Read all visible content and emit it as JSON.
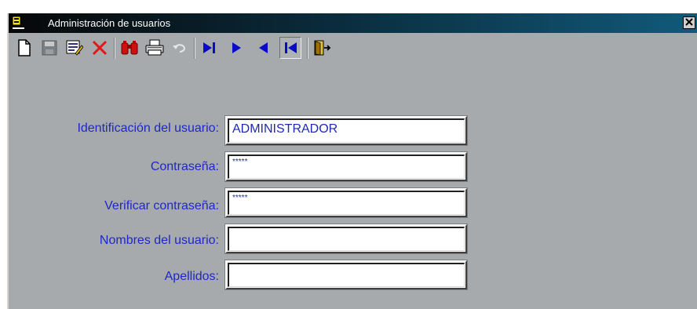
{
  "window": {
    "title": "Administración de usuarios",
    "close_label": "×"
  },
  "toolbar": {
    "buttons": [
      {
        "name": "new-record-button",
        "icon": "new-document-icon"
      },
      {
        "name": "save-button",
        "icon": "save-disk-icon"
      },
      {
        "name": "edit-button",
        "icon": "edit-form-icon"
      },
      {
        "name": "delete-button",
        "icon": "delete-x-icon"
      },
      {
        "name": "find-button",
        "icon": "binoculars-icon"
      },
      {
        "name": "print-button",
        "icon": "printer-icon"
      },
      {
        "name": "undo-button",
        "icon": "undo-icon"
      },
      {
        "name": "last-record-button",
        "icon": "last-record-icon"
      },
      {
        "name": "next-record-button",
        "icon": "next-record-icon"
      },
      {
        "name": "previous-record-button",
        "icon": "previous-record-icon"
      },
      {
        "name": "first-record-button",
        "icon": "first-record-icon"
      },
      {
        "name": "exit-button",
        "icon": "exit-door-icon"
      }
    ]
  },
  "form": {
    "user_id_label": "Identificación del usuario:",
    "user_id_value": "ADMINISTRADOR",
    "password_label": "Contraseña:",
    "password_value": "*****",
    "verify_label": "Verificar contraseña:",
    "verify_value": "*****",
    "names_label": "Nombres del usuario:",
    "names_value": "",
    "surnames_label": "Apellidos:",
    "surnames_value": ""
  },
  "colors": {
    "label_blue": "#1f27c8",
    "window_gray": "#a6aaad",
    "title_dark": "#070707",
    "title_teal": "#115a7a"
  }
}
